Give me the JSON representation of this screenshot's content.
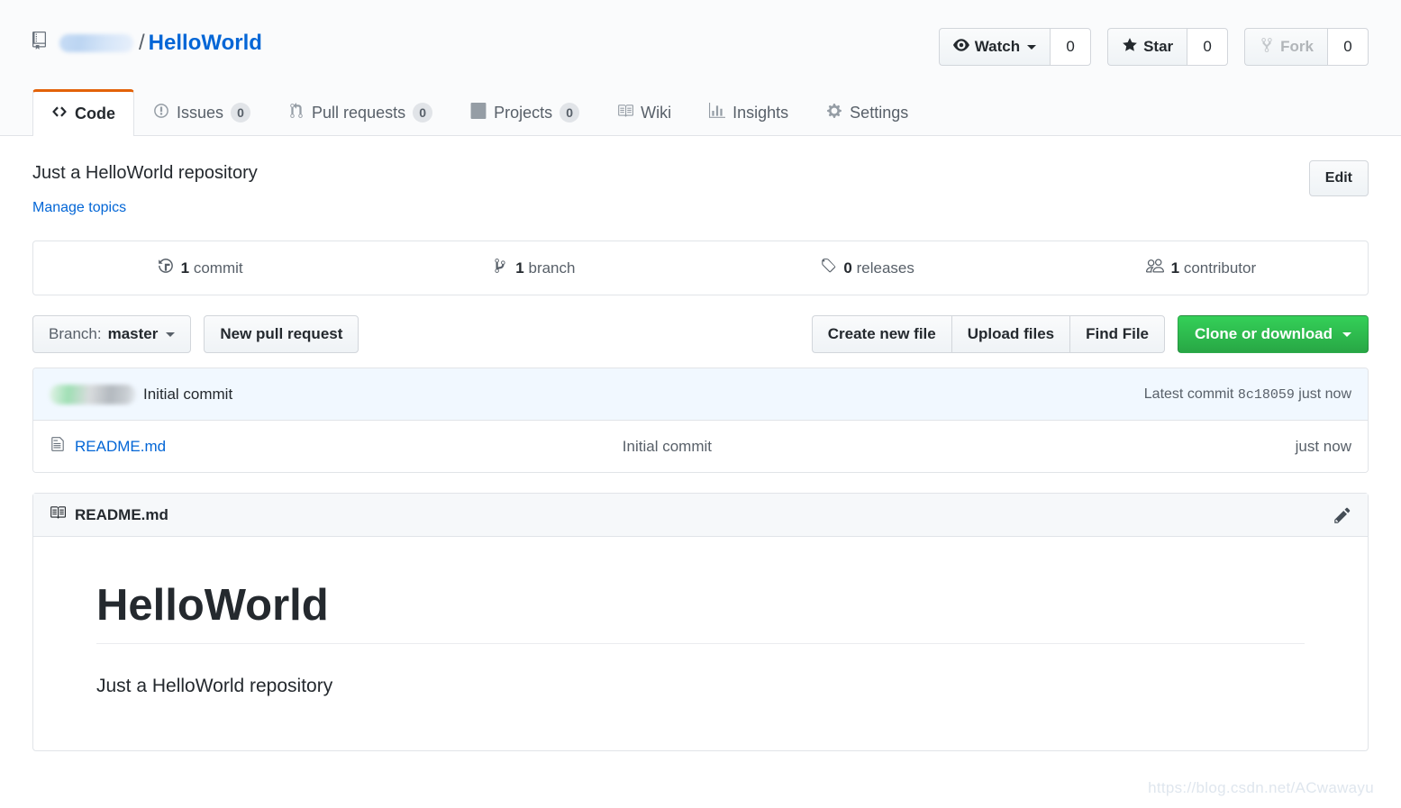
{
  "header": {
    "repo_icon": "repo-book-icon",
    "owner_redacted": true,
    "separator": "/",
    "repo_name": "HelloWorld",
    "social": [
      {
        "id": "watch",
        "icon": "eye-icon",
        "label": "Watch",
        "has_caret": true,
        "count": "0",
        "disabled": false
      },
      {
        "id": "star",
        "icon": "star-icon",
        "label": "Star",
        "has_caret": false,
        "count": "0",
        "disabled": false
      },
      {
        "id": "fork",
        "icon": "fork-icon",
        "label": "Fork",
        "has_caret": false,
        "count": "0",
        "disabled": true
      }
    ]
  },
  "tabs": [
    {
      "id": "code",
      "icon": "code-icon",
      "label": "Code",
      "count": null,
      "selected": true
    },
    {
      "id": "issues",
      "icon": "issue-opened-icon",
      "label": "Issues",
      "count": "0",
      "selected": false
    },
    {
      "id": "pull-requests",
      "icon": "git-pull-request-icon",
      "label": "Pull requests",
      "count": "0",
      "selected": false
    },
    {
      "id": "projects",
      "icon": "project-board-icon",
      "label": "Projects",
      "count": "0",
      "selected": false
    },
    {
      "id": "wiki",
      "icon": "book-icon",
      "label": "Wiki",
      "count": null,
      "selected": false
    },
    {
      "id": "insights",
      "icon": "graph-bar-icon",
      "label": "Insights",
      "count": null,
      "selected": false
    },
    {
      "id": "settings",
      "icon": "gear-icon",
      "label": "Settings",
      "count": null,
      "selected": false
    }
  ],
  "description": {
    "text": "Just a HelloWorld repository",
    "manage_topics_label": "Manage topics",
    "edit_label": "Edit"
  },
  "overview": [
    {
      "id": "commits",
      "icon": "history-icon",
      "value": "1",
      "label": "commit"
    },
    {
      "id": "branches",
      "icon": "git-branch-icon",
      "value": "1",
      "label": "branch"
    },
    {
      "id": "releases",
      "icon": "tag-icon",
      "value": "0",
      "label": "releases"
    },
    {
      "id": "contributors",
      "icon": "people-icon",
      "value": "1",
      "label": "contributor"
    }
  ],
  "actionbar": {
    "branch_prefix": "Branch:",
    "branch_name": "master",
    "new_pull_request": "New pull request",
    "create_new_file": "Create new file",
    "upload_files": "Upload files",
    "find_file": "Find File",
    "clone_or_download": "Clone or download"
  },
  "commit_row": {
    "author_redacted": true,
    "message": "Initial commit",
    "latest_commit_label": "Latest commit",
    "sha": "8c18059",
    "time": "just now"
  },
  "files": [
    {
      "icon": "file-icon",
      "name": "README.md",
      "message": "Initial commit",
      "age": "just now"
    }
  ],
  "readme": {
    "icon": "book-open-icon",
    "title": "README.md",
    "edit_icon": "pencil-icon",
    "heading": "HelloWorld",
    "paragraph": "Just a HelloWorld repository"
  },
  "watermark": "https://blog.csdn.net/ACwawayu",
  "colors": {
    "link": "#0366d6",
    "green_button": "#28a745",
    "active_tab_border": "#e36209",
    "commit_row_bg": "#f1f8ff",
    "border": "#e1e4e8"
  }
}
